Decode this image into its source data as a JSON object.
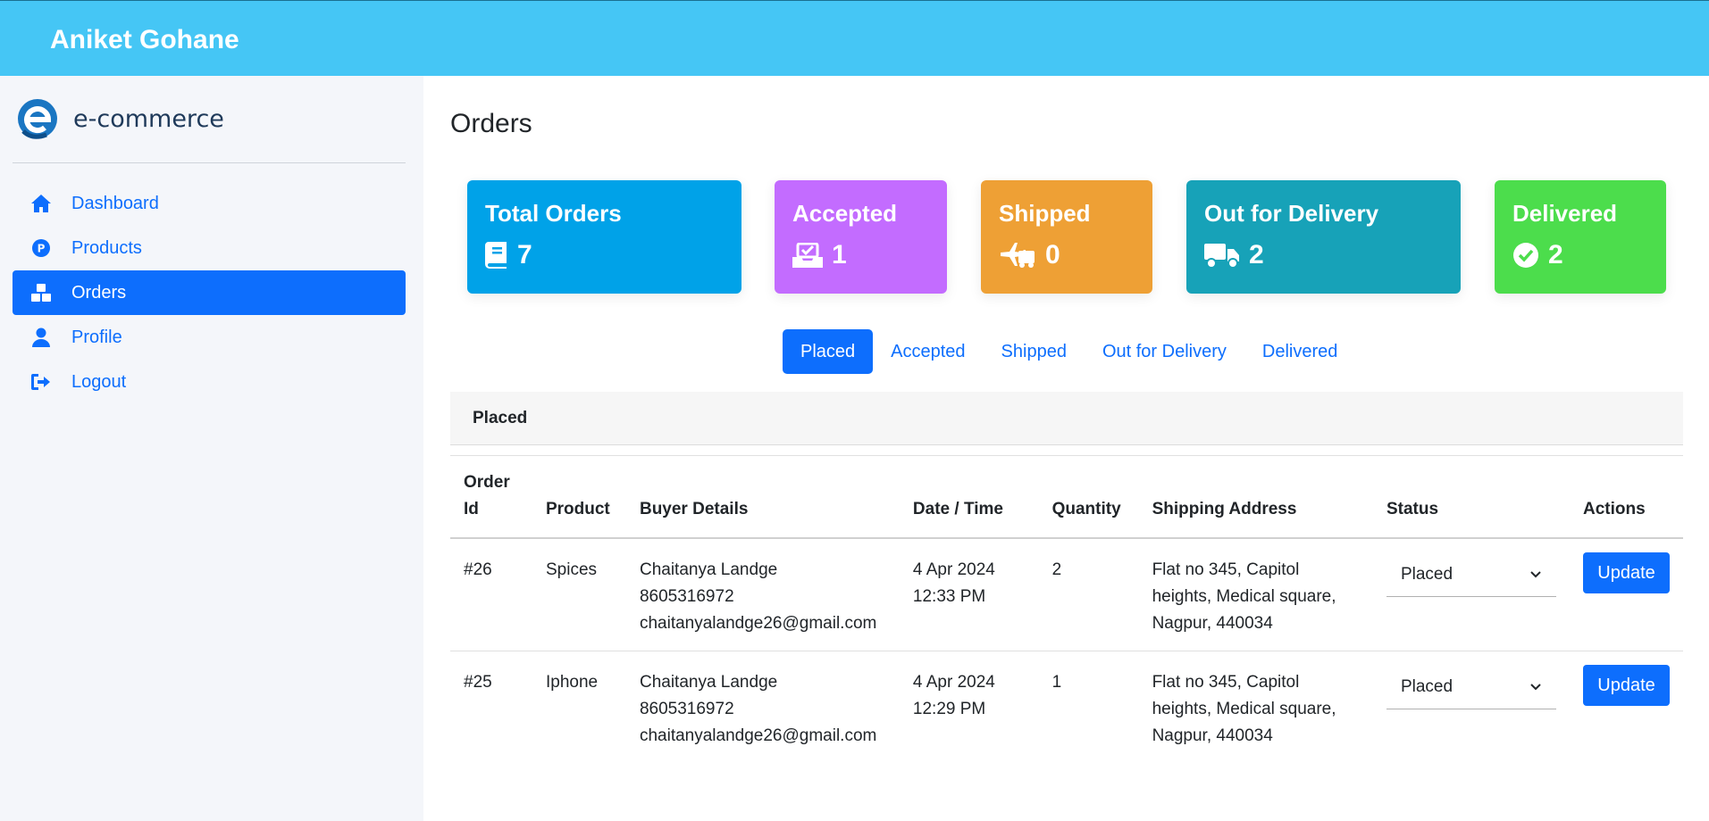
{
  "header": {
    "brand": "Aniket Gohane"
  },
  "sidebar": {
    "logo_text": "e-commerce",
    "items": [
      {
        "label": "Dashboard",
        "icon": "home-icon"
      },
      {
        "label": "Products",
        "icon": "product-icon"
      },
      {
        "label": "Orders",
        "icon": "boxes-icon",
        "active": true
      },
      {
        "label": "Profile",
        "icon": "user-icon"
      },
      {
        "label": "Logout",
        "icon": "logout-icon"
      }
    ]
  },
  "page": {
    "title": "Orders"
  },
  "stats": [
    {
      "title": "Total Orders",
      "value": "7",
      "icon": "book-icon",
      "color": "#00a2e8"
    },
    {
      "title": "Accepted",
      "value": "1",
      "icon": "inbox-check-icon",
      "color": "#c36cff"
    },
    {
      "title": "Shipped",
      "value": "0",
      "icon": "plane-truck-icon",
      "color": "#eea035"
    },
    {
      "title": "Out for Delivery",
      "value": "2",
      "icon": "truck-icon",
      "color": "#17a2b8"
    },
    {
      "title": "Delivered",
      "value": "2",
      "icon": "check-circle-icon",
      "color": "#4cdd4c"
    }
  ],
  "tabs": [
    "Placed",
    "Accepted",
    "Shipped",
    "Out for Delivery",
    "Delivered"
  ],
  "section": {
    "title": "Placed"
  },
  "table": {
    "headers": [
      "Order Id",
      "Product",
      "Buyer Details",
      "Date / Time",
      "Quantity",
      "Shipping Address",
      "Status",
      "Actions"
    ],
    "rows": [
      {
        "order_id": "#26",
        "product": "Spices",
        "buyer_name": "Chaitanya Landge",
        "buyer_phone": "8605316972",
        "buyer_email": "chaitanyalandge26@gmail.com",
        "date": "4 Apr 2024",
        "time": "12:33 PM",
        "quantity": "2",
        "address_line1": "Flat no 345, Capitol",
        "address_line2": "heights, Medical square,",
        "address_line3": "Nagpur, 440034",
        "status": "Placed",
        "action": "Update"
      },
      {
        "order_id": "#25",
        "product": "Iphone",
        "buyer_name": "Chaitanya Landge",
        "buyer_phone": "8605316972",
        "buyer_email": "chaitanyalandge26@gmail.com",
        "date": "4 Apr 2024",
        "time": "12:29 PM",
        "quantity": "1",
        "address_line1": "Flat no 345, Capitol",
        "address_line2": "heights, Medical square,",
        "address_line3": "Nagpur, 440034",
        "status": "Placed",
        "action": "Update"
      }
    ]
  }
}
